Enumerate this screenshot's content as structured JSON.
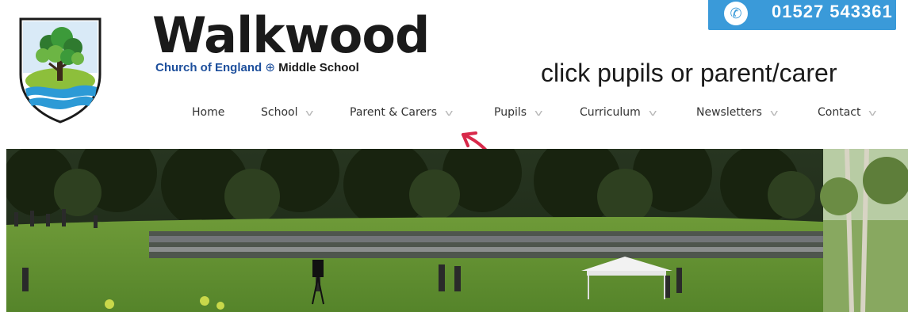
{
  "brand": {
    "name": "Walkwood",
    "subtitle_blue": "Church of England",
    "subtitle_dark": "Middle School"
  },
  "contact": {
    "phone_number": "01527 543361",
    "icon": "phone-icon"
  },
  "annotation": {
    "text": "click pupils or parent/carer",
    "arrow_color": "#d8294a"
  },
  "nav": {
    "items": [
      {
        "label": "Home",
        "has_dropdown": false
      },
      {
        "label": "School",
        "has_dropdown": true
      },
      {
        "label": "Parent & Carers",
        "has_dropdown": true
      },
      {
        "label": "Pupils",
        "has_dropdown": true
      },
      {
        "label": "Curriculum",
        "has_dropdown": true
      },
      {
        "label": "Newsletters",
        "has_dropdown": true
      },
      {
        "label": "Contact",
        "has_dropdown": true
      }
    ]
  },
  "colors": {
    "brand_blue": "#1d4f9c",
    "phone_bar": "#3a9ad9",
    "grass": "#5f8a2e",
    "trees": "#1f2a18"
  }
}
